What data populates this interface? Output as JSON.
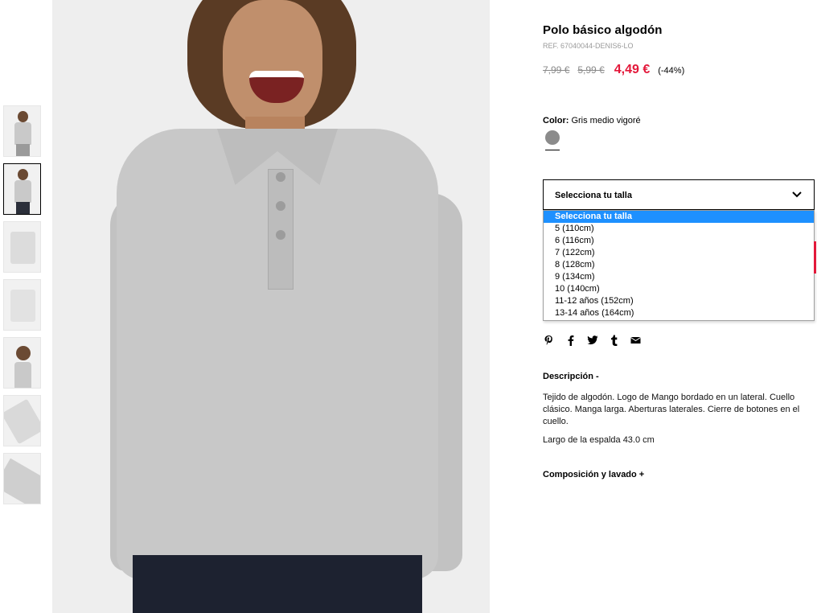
{
  "product": {
    "title": "Polo básico algodón",
    "ref": "REF. 67040044-DENIS6-LO",
    "price_original": "7,99 €",
    "price_previous": "5,99 €",
    "price_sale": "4,49 €",
    "discount": "(-44%)"
  },
  "color": {
    "label": "Color:",
    "value": "Gris medio vigoré",
    "swatch_hex": "#8b8b8b"
  },
  "size_select": {
    "placeholder": "Selecciona tu talla",
    "options": [
      "Selecciona tu talla",
      "5 (110cm)",
      "6 (116cm)",
      "7 (122cm)",
      "8 (128cm)",
      "9 (134cm)",
      "10 (140cm)",
      "11-12 años (152cm)",
      "13-14 años (164cm)"
    ]
  },
  "social": {
    "icons": [
      "pinterest-icon",
      "facebook-icon",
      "twitter-icon",
      "tumblr-icon",
      "email-icon"
    ]
  },
  "description": {
    "heading": "Descripción  -",
    "text": "Tejido de algodón. Logo de Mango bordado en un lateral. Cuello clásico. Manga larga. Aberturas laterales. Cierre de botones en el cuello.",
    "length": "Largo de la espalda 43.0 cm"
  },
  "composition": {
    "heading": "Composición y lavado  +"
  },
  "colors": {
    "sale": "#e3183a",
    "highlight": "#1e90ff"
  }
}
